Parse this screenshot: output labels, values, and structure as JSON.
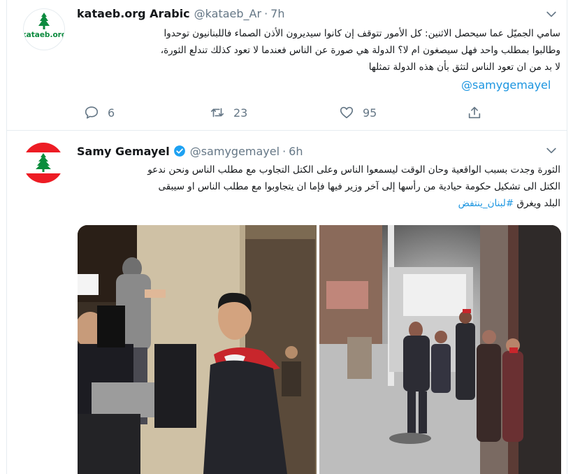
{
  "tweets": [
    {
      "author_name": "kataeb.org Arabic",
      "handle": "@kataeb_Ar",
      "separator": "·",
      "time": "7h",
      "avatar_text": "kataeb.org",
      "text_lines": [
        "سامي الجميّل عما سيحصل الاثنين: كل الأمور تتوقف إن كانوا سيديرون الأذن الصماء فاللبنانيون توحدوا",
        "وطالبوا بمطلب واحد فهل سيصغون ام لا؟ الدولة هي صورة عن الناس فعندما لا تعود كذلك تندلع الثورة،",
        "لا بد من ان تعود الناس لتثق بأن هذه الدولة تمثلها"
      ],
      "mention": "@samygemayel",
      "replies": "6",
      "retweets": "23",
      "likes": "95"
    },
    {
      "author_name": "Samy Gemayel",
      "handle": "@samygemayel",
      "separator": "·",
      "time": "6h",
      "text_lines": [
        "الثورة وجدت بسبب الواقعية وحان الوقت ليسمعوا الناس وعلى الكتل التجاوب مع مطلب الناس ونحن ندعو",
        "الكتل الى تشكيل حكومة حيادية من رأسها إلى آخر وزير فيها فإما ان يتجاوبوا مع مطلب الناس او سيبقى"
      ],
      "line3_prefix": "البلد ويغرق",
      "hashtag": "#لبنان_ينتفض"
    }
  ],
  "colors": {
    "link": "#1b95e0",
    "secondary_text": "#657786",
    "border": "#e6ecf0",
    "kataeb_green": "#0c8a3e",
    "lebanon_red": "#ed1c24"
  },
  "icons": [
    "reply-icon",
    "retweet-icon",
    "like-icon",
    "share-icon",
    "chevron-down-icon",
    "verified-badge-icon",
    "cedar-icon"
  ]
}
